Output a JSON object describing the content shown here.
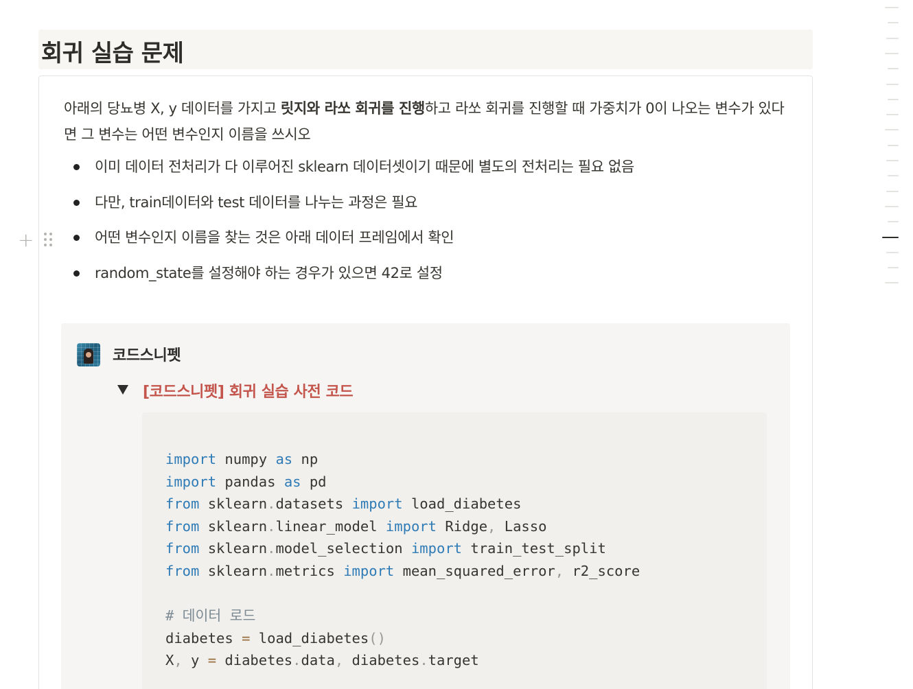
{
  "heading": "회귀 실습 문제",
  "intro": {
    "part1": "아래의 당뇨병 X, y 데이터를 가지고 ",
    "bold": "릿지와 라쏘 회귀를 진행",
    "part2": "하고 라쏘 회귀를 진행할 때 가중치가 0이 나오는 변수가 있다면 그 변수는 어떤 변수인지 이름을 쓰시오"
  },
  "bullets": [
    "이미 데이터 전처리가 다 이루어진 sklearn 데이터셋이기 때문에 별도의 전처리는 필요 없음",
    "다만, train데이터와 test 데이터를 나누는 과정은 필요",
    "어떤 변수인지 이름을 찾는 것은 아래 데이터 프레임에서 확인",
    "random_state를 설정해야 하는 경우가 있으면 42로 설정"
  ],
  "handles": {
    "plus_icon": "+",
    "drag_icon": "drag-handle"
  },
  "callout": {
    "icon": "codesnippet-avatar-icon",
    "title": "코드스니펫",
    "toggle_title": "[코드스니펫] 회귀 실습 사전 코드"
  },
  "code_lines": [
    [
      [
        "kw",
        "import"
      ],
      [
        "t",
        " numpy "
      ],
      [
        "kw",
        "as"
      ],
      [
        "t",
        " np"
      ]
    ],
    [
      [
        "kw",
        "import"
      ],
      [
        "t",
        " pandas "
      ],
      [
        "kw",
        "as"
      ],
      [
        "t",
        " pd"
      ]
    ],
    [
      [
        "kw",
        "from"
      ],
      [
        "t",
        " sklearn"
      ],
      [
        "pn",
        "."
      ],
      [
        "t",
        "datasets "
      ],
      [
        "kw",
        "import"
      ],
      [
        "t",
        " load_diabetes"
      ]
    ],
    [
      [
        "kw",
        "from"
      ],
      [
        "t",
        " sklearn"
      ],
      [
        "pn",
        "."
      ],
      [
        "t",
        "linear_model "
      ],
      [
        "kw",
        "import"
      ],
      [
        "t",
        " Ridge"
      ],
      [
        "pn",
        ","
      ],
      [
        "t",
        " Lasso"
      ]
    ],
    [
      [
        "kw",
        "from"
      ],
      [
        "t",
        " sklearn"
      ],
      [
        "pn",
        "."
      ],
      [
        "t",
        "model_selection "
      ],
      [
        "kw",
        "import"
      ],
      [
        "t",
        " train_test_split"
      ]
    ],
    [
      [
        "kw",
        "from"
      ],
      [
        "t",
        " sklearn"
      ],
      [
        "pn",
        "."
      ],
      [
        "t",
        "metrics "
      ],
      [
        "kw",
        "import"
      ],
      [
        "t",
        " mean_squared_error"
      ],
      [
        "pn",
        ","
      ],
      [
        "t",
        " r2_score"
      ]
    ],
    [],
    [
      [
        "cm",
        "# 데이터 로드"
      ]
    ],
    [
      [
        "t",
        "diabetes "
      ],
      [
        "op",
        "="
      ],
      [
        "t",
        " load_diabetes"
      ],
      [
        "pn",
        "()"
      ]
    ],
    [
      [
        "t",
        "X"
      ],
      [
        "pn",
        ","
      ],
      [
        "t",
        " y "
      ],
      [
        "op",
        "="
      ],
      [
        "t",
        " diabetes"
      ],
      [
        "pn",
        "."
      ],
      [
        "t",
        "data"
      ],
      [
        "pn",
        ","
      ],
      [
        "t",
        " diabetes"
      ],
      [
        "pn",
        "."
      ],
      [
        "t",
        "target"
      ]
    ]
  ],
  "minimap": {
    "line_count": 19,
    "active_index": 15
  }
}
